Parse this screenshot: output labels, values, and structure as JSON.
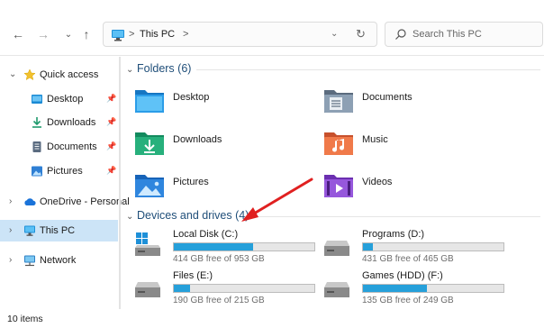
{
  "toolbar": {
    "back_icon": "arrow-left-icon",
    "forward_icon": "arrow-right-icon",
    "up_icon": "arrow-up-icon",
    "address": {
      "location": "This PC",
      "separator": ">",
      "dropdown_icon": "chevron-down-icon",
      "refresh_icon": "refresh-icon"
    },
    "search": {
      "placeholder": "Search This PC",
      "value": ""
    }
  },
  "sidebar": {
    "items": [
      {
        "label": "Quick access",
        "icon": "star-icon",
        "expanded": true
      },
      {
        "label": "Desktop",
        "icon": "desktop-folder-icon",
        "pinned": true
      },
      {
        "label": "Downloads",
        "icon": "download-icon",
        "pinned": true
      },
      {
        "label": "Documents",
        "icon": "documents-icon",
        "pinned": true
      },
      {
        "label": "Pictures",
        "icon": "pictures-icon",
        "pinned": true
      },
      {
        "label": "OneDrive - Personal",
        "icon": "cloud-icon"
      },
      {
        "label": "This PC",
        "icon": "pc-icon",
        "selected": true
      },
      {
        "label": "Network",
        "icon": "network-icon"
      }
    ]
  },
  "main": {
    "folders": {
      "header": "Folders (6)",
      "items": [
        {
          "label": "Desktop",
          "icon": "desktop-folder-icon"
        },
        {
          "label": "Documents",
          "icon": "documents-folder-icon"
        },
        {
          "label": "Downloads",
          "icon": "downloads-folder-icon"
        },
        {
          "label": "Music",
          "icon": "music-folder-icon"
        },
        {
          "label": "Pictures",
          "icon": "pictures-folder-icon"
        },
        {
          "label": "Videos",
          "icon": "videos-folder-icon"
        }
      ]
    },
    "drives": {
      "header": "Devices and drives (4)",
      "items": [
        {
          "name": "Local Disk (C:)",
          "free": "414 GB free of 953 GB",
          "used_fraction": 0.566,
          "icon": "windows-drive-icon"
        },
        {
          "name": "Programs  (D:)",
          "free": "431 GB free of 465 GB",
          "used_fraction": 0.073,
          "icon": "hard-drive-icon"
        },
        {
          "name": "Files (E:)",
          "free": "190 GB free of 215 GB",
          "used_fraction": 0.116,
          "icon": "hard-drive-icon"
        },
        {
          "name": "Games (HDD) (F:)",
          "free": "135 GB free of 249 GB",
          "used_fraction": 0.458,
          "icon": "hard-drive-icon"
        }
      ]
    }
  },
  "status": {
    "items_count": "10 items"
  },
  "colors": {
    "accent": "#26a0da",
    "selection": "#cce4f7",
    "annotation_arrow": "#e02020"
  }
}
